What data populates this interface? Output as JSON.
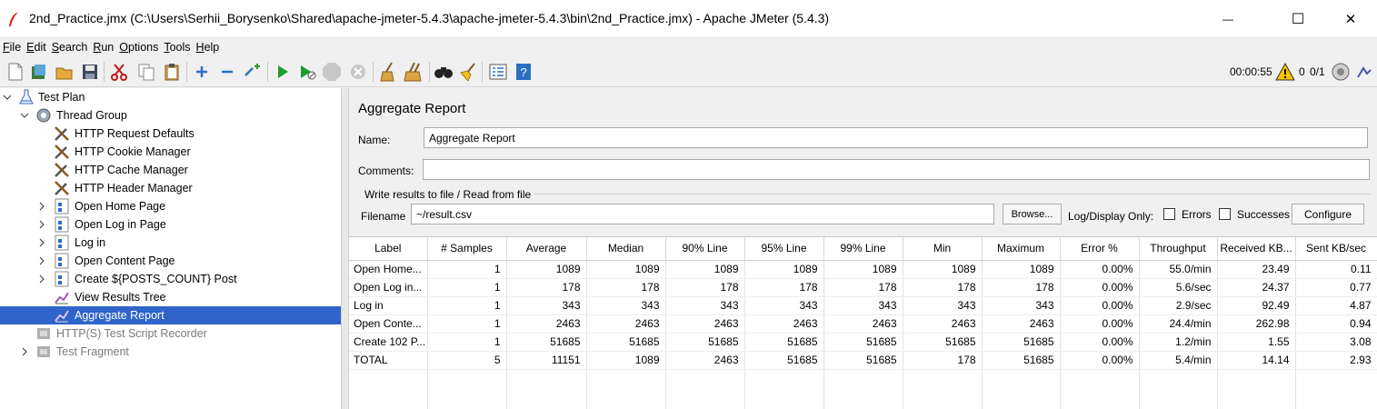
{
  "window": {
    "title": "2nd_Practice.jmx (C:\\Users\\Serhii_Borysenko\\Shared\\apache-jmeter-5.4.3\\apache-jmeter-5.4.3\\bin\\2nd_Practice.jmx) - Apache JMeter (5.4.3)",
    "minimize_glyph": "—",
    "maximize_glyph": "☐",
    "close_glyph": "✕"
  },
  "menu": {
    "items": [
      {
        "mnemonic": "F",
        "rest": "ile"
      },
      {
        "mnemonic": "E",
        "rest": "dit"
      },
      {
        "mnemonic": "S",
        "rest": "earch"
      },
      {
        "mnemonic": "R",
        "rest": "un"
      },
      {
        "mnemonic": "O",
        "rest": "ptions"
      },
      {
        "mnemonic": "T",
        "rest": "ools"
      },
      {
        "mnemonic": "H",
        "rest": "elp"
      }
    ]
  },
  "toolbar": {
    "elapsed_time": "00:00:55",
    "warnings_count": "0",
    "threads": "0/1"
  },
  "tree": {
    "items": [
      {
        "label": "Test Plan",
        "icon": "test-plan-icon",
        "state": "normal"
      },
      {
        "label": "Thread Group",
        "icon": "thread-group-gear-icon",
        "state": "normal"
      },
      {
        "label": "HTTP Request Defaults",
        "icon": "config-tools-icon",
        "state": "normal"
      },
      {
        "label": "HTTP Cookie Manager",
        "icon": "config-tools-icon",
        "state": "normal"
      },
      {
        "label": "HTTP Cache Manager",
        "icon": "config-tools-icon",
        "state": "normal"
      },
      {
        "label": "HTTP Header Manager",
        "icon": "config-tools-icon",
        "state": "normal"
      },
      {
        "label": "Open Home Page",
        "icon": "transaction-controller-icon",
        "state": "normal"
      },
      {
        "label": "Open Log in Page",
        "icon": "transaction-controller-icon",
        "state": "normal"
      },
      {
        "label": "Log in",
        "icon": "transaction-controller-icon",
        "state": "normal"
      },
      {
        "label": "Open Content Page",
        "icon": "transaction-controller-icon",
        "state": "normal"
      },
      {
        "label": "Create ${POSTS_COUNT} Post",
        "icon": "transaction-controller-icon",
        "state": "normal"
      },
      {
        "label": "View Results Tree",
        "icon": "listener-graph-icon",
        "state": "normal"
      },
      {
        "label": "Aggregate Report",
        "icon": "listener-graph-icon",
        "state": "selected"
      },
      {
        "label": "HTTP(S) Test Script Recorder",
        "icon": "recorder-icon",
        "state": "disabled"
      },
      {
        "label": "Test Fragment",
        "icon": "test-fragment-icon",
        "state": "disabled"
      }
    ]
  },
  "panel": {
    "title": "Aggregate Report",
    "name_label": "Name:",
    "name_value": "Aggregate Report",
    "comments_label": "Comments:",
    "comments_value": "",
    "file_group_label": "Write results to file / Read from file",
    "filename_label": "Filename",
    "filename_value": "~/result.csv",
    "browse_label": "Browse...",
    "log_display_label": "Log/Display Only:",
    "errors_label": "Errors",
    "successes_label": "Successes",
    "configure_label": "Configure"
  },
  "table": {
    "columns": [
      "Label",
      "# Samples",
      "Average",
      "Median",
      "90% Line",
      "95% Line",
      "99% Line",
      "Min",
      "Maximum",
      "Error %",
      "Throughput",
      "Received KB...",
      "Sent KB/sec"
    ],
    "rows": [
      [
        "Open Home...",
        "1",
        "1089",
        "1089",
        "1089",
        "1089",
        "1089",
        "1089",
        "1089",
        "0.00%",
        "55.0/min",
        "23.49",
        "0.11"
      ],
      [
        "Open Log in...",
        "1",
        "178",
        "178",
        "178",
        "178",
        "178",
        "178",
        "178",
        "0.00%",
        "5.6/sec",
        "24.37",
        "0.77"
      ],
      [
        "Log in",
        "1",
        "343",
        "343",
        "343",
        "343",
        "343",
        "343",
        "343",
        "0.00%",
        "2.9/sec",
        "92.49",
        "4.87"
      ],
      [
        "Open Conte...",
        "1",
        "2463",
        "2463",
        "2463",
        "2463",
        "2463",
        "2463",
        "2463",
        "0.00%",
        "24.4/min",
        "262.98",
        "0.94"
      ],
      [
        "Create 102 P...",
        "1",
        "51685",
        "51685",
        "51685",
        "51685",
        "51685",
        "51685",
        "51685",
        "0.00%",
        "1.2/min",
        "1.55",
        "3.08"
      ],
      [
        "TOTAL",
        "5",
        "11151",
        "1089",
        "2463",
        "51685",
        "51685",
        "178",
        "51685",
        "0.00%",
        "5.4/min",
        "14.14",
        "2.93"
      ]
    ]
  },
  "colors": {
    "selection": "#2f65ca",
    "warning": "#f5c400",
    "run_green": "#1c9c2d"
  }
}
